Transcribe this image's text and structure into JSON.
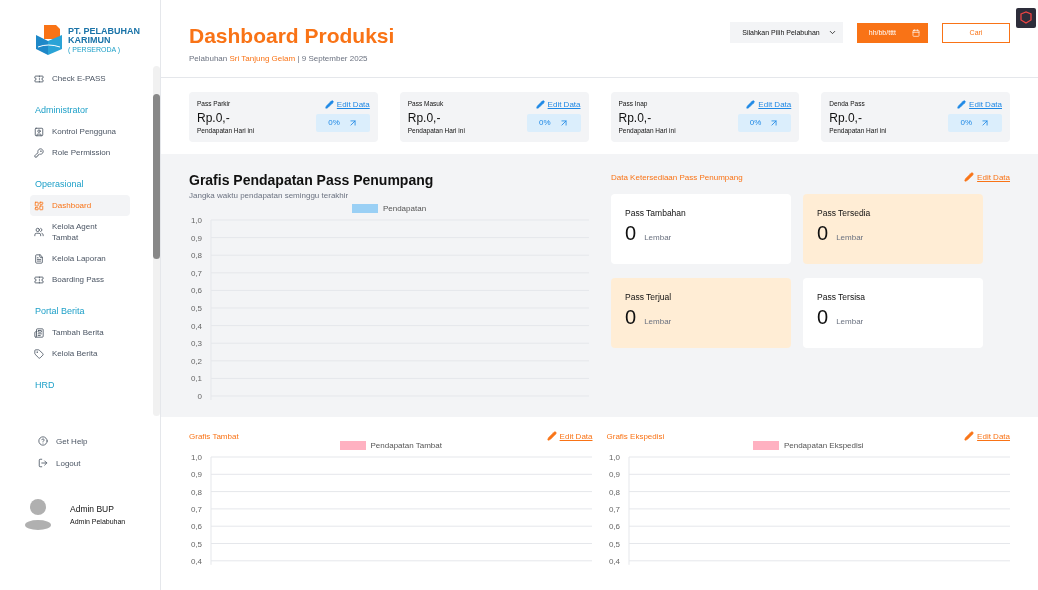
{
  "sidebar": {
    "logo": {
      "line1": "PT. PELABUHAN",
      "line2": "KARIMUN",
      "line3": "( PERSERODA )"
    },
    "nav": [
      {
        "kind": "item",
        "label": "Check E-PASS",
        "selected": false
      },
      {
        "kind": "section",
        "label": "Administrator"
      },
      {
        "kind": "item",
        "label": "Kontrol Pengguna",
        "selected": false
      },
      {
        "kind": "item",
        "label": "Role Permission",
        "selected": false
      },
      {
        "kind": "section",
        "label": "Operasional"
      },
      {
        "kind": "item",
        "label": "Dashboard",
        "selected": true
      },
      {
        "kind": "item",
        "label": "Kelola Agent Tambat",
        "selected": false
      },
      {
        "kind": "item",
        "label": "Kelola Laporan",
        "selected": false
      },
      {
        "kind": "item",
        "label": "Boarding Pass",
        "selected": false
      },
      {
        "kind": "section",
        "label": "Portal Berita"
      },
      {
        "kind": "item",
        "label": "Tambah Berita",
        "selected": false
      },
      {
        "kind": "item",
        "label": "Kelola Berita",
        "selected": false
      },
      {
        "kind": "section",
        "label": "HRD"
      }
    ],
    "bottom": [
      {
        "label": "Get Help"
      },
      {
        "label": "Logout"
      }
    ],
    "user": {
      "name": "Admin BUP",
      "role": "Admin Pelabuhan"
    }
  },
  "header": {
    "title": "Dashboard Produksi",
    "subtitle_prefix": "Pelabuhan",
    "port": "Sri Tanjung Gelam",
    "separator": "|",
    "date": "9 September 2025",
    "port_select": "Silahkan Pilih Pelabuhan",
    "date_placeholder": "hh/bb/tttt",
    "search_button": "Cari"
  },
  "stats": [
    {
      "label": "Pass Parkir",
      "edit": "Edit Data",
      "value": "Rp.0,-",
      "caption": "Pendapatan Hari ini",
      "change": "0%"
    },
    {
      "label": "Pass Masuk",
      "edit": "Edit Data",
      "value": "Rp.0,-",
      "caption": "Pendapatan Hari ini",
      "change": "0%"
    },
    {
      "label": "Pass Inap",
      "edit": "Edit Data",
      "value": "Rp.0,-",
      "caption": "Pendapatan Hari ini",
      "change": "0%"
    },
    {
      "label": "Denda Pass",
      "edit": "Edit Data",
      "value": "Rp.0,-",
      "caption": "Pendapatan Hari ini",
      "change": "0%"
    }
  ],
  "main_chart": {
    "title": "Grafis Pendapatan Pass Penumpang",
    "subtitle": "Jangka waktu pendapatan seminggu terakhir",
    "chart_data": {
      "type": "bar",
      "series": [
        {
          "name": "Pendapatan",
          "color": "#9ad0f5"
        }
      ],
      "ylim": [
        0,
        1
      ],
      "grid": true,
      "yticks": [
        {
          "value": 1,
          "label": "1,0"
        },
        {
          "value": 0.9,
          "label": "0,9"
        },
        {
          "value": 0.8,
          "label": "0,8"
        },
        {
          "value": 0.7,
          "label": "0,7"
        },
        {
          "value": 0.6,
          "label": "0,6"
        },
        {
          "value": 0.5,
          "label": "0,5"
        },
        {
          "value": 0.4,
          "label": "0,4"
        },
        {
          "value": 0.3,
          "label": "0,3"
        },
        {
          "value": 0.2,
          "label": "0,2"
        },
        {
          "value": 0.1,
          "label": "0,1"
        },
        {
          "value": 0,
          "label": "0"
        }
      ]
    }
  },
  "availability": {
    "title": "Data Ketersediaan Pass Penumpang",
    "edit": "Edit Data",
    "cards": [
      {
        "label": "Pass Tambahan",
        "value": "0",
        "unit": "Lembar",
        "highlight": false
      },
      {
        "label": "Pass Tersedia",
        "value": "0",
        "unit": "Lembar",
        "highlight": true
      },
      {
        "label": "Pass Terjual",
        "value": "0",
        "unit": "Lembar",
        "highlight": true
      },
      {
        "label": "Pass Tersisa",
        "value": "0",
        "unit": "Lembar",
        "highlight": false
      }
    ]
  },
  "bottom_charts": [
    {
      "title": "Grafis Tambat",
      "edit": "Edit Data",
      "chart_data": {
        "type": "bar",
        "series": [
          {
            "name": "Pendapatan Tambat",
            "color": "#ffb1c1"
          }
        ],
        "ylim": [
          0.4,
          1
        ],
        "grid": true,
        "yticks": [
          {
            "value": 1,
            "label": "1,0"
          },
          {
            "value": 0.9,
            "label": "0,9"
          },
          {
            "value": 0.8,
            "label": "0,8"
          },
          {
            "value": 0.7,
            "label": "0,7"
          },
          {
            "value": 0.6,
            "label": "0,6"
          },
          {
            "value": 0.5,
            "label": "0,5"
          },
          {
            "value": 0.4,
            "label": "0,4"
          }
        ]
      }
    },
    {
      "title": "Grafis Ekspedisi",
      "edit": "Edit Data",
      "chart_data": {
        "type": "bar",
        "series": [
          {
            "name": "Pendapatan Ekspedisi",
            "color": "#ffb1c1"
          }
        ],
        "ylim": [
          0.4,
          1
        ],
        "grid": true,
        "yticks": [
          {
            "value": 1,
            "label": "1,0"
          },
          {
            "value": 0.9,
            "label": "0,9"
          },
          {
            "value": 0.8,
            "label": "0,8"
          },
          {
            "value": 0.7,
            "label": "0,7"
          },
          {
            "value": 0.6,
            "label": "0,6"
          },
          {
            "value": 0.5,
            "label": "0,5"
          },
          {
            "value": 0.4,
            "label": "0,4"
          }
        ]
      }
    }
  ]
}
